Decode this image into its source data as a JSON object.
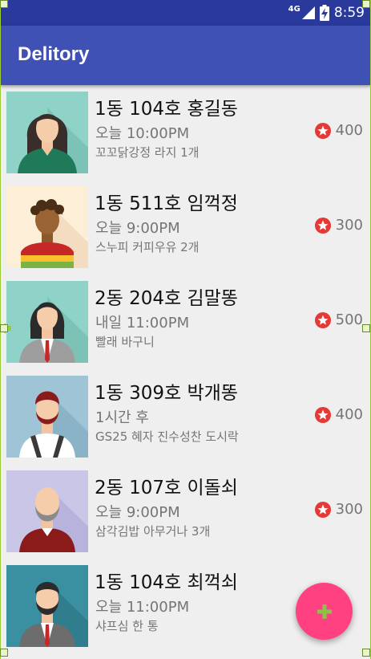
{
  "status_bar": {
    "network": "4G",
    "time": "8:59"
  },
  "app_bar": {
    "title": "Delitory"
  },
  "orders": [
    {
      "title": "1동 104호 홍길동",
      "time": "오늘 10:00PM",
      "item": "꼬꼬닭강정 라지 1개",
      "points": "400",
      "avatar": "woman-long-hair"
    },
    {
      "title": "1동 511호 임꺽정",
      "time": "오늘 9:00PM",
      "item": "스누피 커피우유 2개",
      "points": "300",
      "avatar": "man-curly-hair"
    },
    {
      "title": "2동 204호 김말똥",
      "time": "내일 11:00PM",
      "item": "빨래 바구니",
      "points": "500",
      "avatar": "woman-suit"
    },
    {
      "title": "1동 309호 박개똥",
      "time": "1시간 후",
      "item": "GS25 혜자 진수성찬 도시락",
      "points": "400",
      "avatar": "man-red-beard"
    },
    {
      "title": "2동 107호 이돌쇠",
      "time": "오늘 9:00PM",
      "item": "삼각김밥 아무거나 3개",
      "points": "300",
      "avatar": "bald-man-beard"
    },
    {
      "title": "1동 104호 최꺽쇠",
      "time": "오늘 11:00PM",
      "item": "샤프심 한 통",
      "points": "",
      "avatar": "man-beard-suit"
    }
  ],
  "fab": {
    "icon": "plus-icon"
  },
  "colors": {
    "status_bar": "#2a3a9c",
    "app_bar": "#3f51b5",
    "accent": "#ff4081",
    "star": "#e53935",
    "fab_plus": "#8bc34a"
  }
}
